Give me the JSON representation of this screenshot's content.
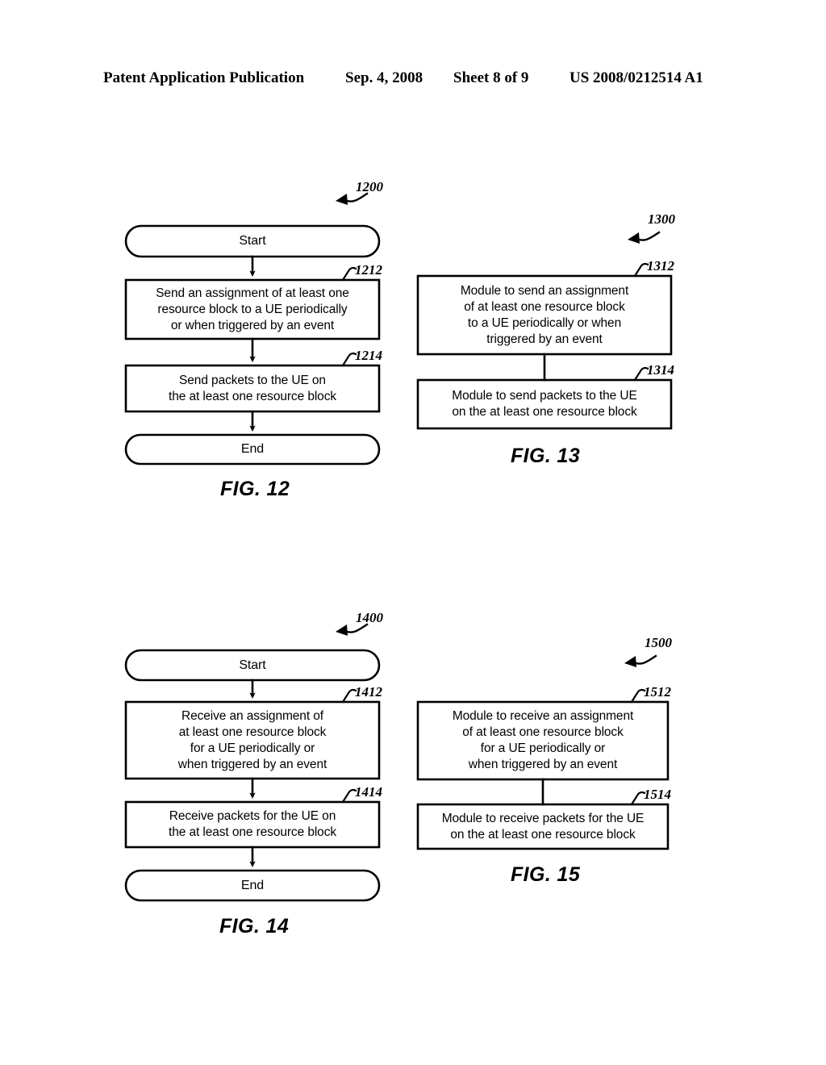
{
  "header": {
    "publication": "Patent Application Publication",
    "date": "Sep. 4, 2008",
    "sheet": "Sheet 8 of 9",
    "patent_number": "US 2008/0212514 A1"
  },
  "figures": [
    {
      "id": "fig12",
      "caption": "FIG. 12",
      "figure_ref": "1200",
      "nodes": [
        {
          "id": "fig12-start",
          "type": "terminal",
          "label": "Start",
          "ref": null
        },
        {
          "id": "fig12-1212",
          "type": "process",
          "ref": "1212",
          "label": "Send an assignment of at least one\nresource block to a UE periodically\nor when triggered by an event"
        },
        {
          "id": "fig12-1214",
          "type": "process",
          "ref": "1214",
          "label": "Send packets to the UE on\nthe at least one resource block"
        },
        {
          "id": "fig12-end",
          "type": "terminal",
          "label": "End",
          "ref": null
        }
      ]
    },
    {
      "id": "fig13",
      "caption": "FIG. 13",
      "figure_ref": "1300",
      "nodes": [
        {
          "id": "fig13-1312",
          "type": "module",
          "ref": "1312",
          "label": "Module to send an assignment\nof at least one resource block\nto a UE periodically or when\ntriggered by an event"
        },
        {
          "id": "fig13-1314",
          "type": "module",
          "ref": "1314",
          "label": "Module to send packets to the UE\non the at least one resource block"
        }
      ]
    },
    {
      "id": "fig14",
      "caption": "FIG. 14",
      "figure_ref": "1400",
      "nodes": [
        {
          "id": "fig14-start",
          "type": "terminal",
          "label": "Start",
          "ref": null
        },
        {
          "id": "fig14-1412",
          "type": "process",
          "ref": "1412",
          "label": "Receive an assignment of\nat least one resource block\nfor a UE periodically or\nwhen triggered by an event"
        },
        {
          "id": "fig14-1414",
          "type": "process",
          "ref": "1414",
          "label": "Receive packets for the UE on\nthe at least one resource block"
        },
        {
          "id": "fig14-end",
          "type": "terminal",
          "label": "End",
          "ref": null
        }
      ]
    },
    {
      "id": "fig15",
      "caption": "FIG. 15",
      "figure_ref": "1500",
      "nodes": [
        {
          "id": "fig15-1512",
          "type": "module",
          "ref": "1512",
          "label": "Module to receive an assignment\nof at least one resource block\nfor a UE periodically or\nwhen triggered by an event"
        },
        {
          "id": "fig15-1514",
          "type": "module",
          "ref": "1514",
          "label": "Module to receive packets for the UE\non the at least one resource block"
        }
      ]
    }
  ],
  "colors": {
    "ink": "#000000",
    "paper": "#ffffff"
  }
}
